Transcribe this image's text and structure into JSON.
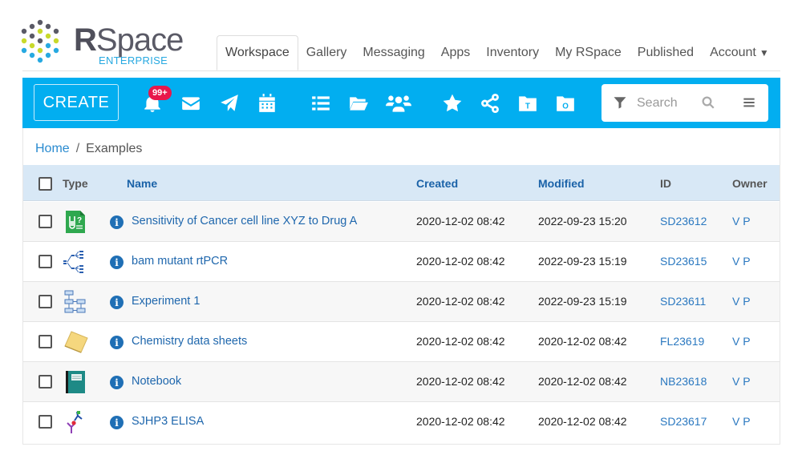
{
  "app": {
    "logo_text_bold": "R",
    "logo_text": "Space",
    "logo_subtitle": "ENTERPRISE"
  },
  "nav": {
    "tabs": [
      {
        "label": "Workspace",
        "active": true
      },
      {
        "label": "Gallery"
      },
      {
        "label": "Messaging"
      },
      {
        "label": "Apps"
      },
      {
        "label": "Inventory"
      },
      {
        "label": "My RSpace"
      },
      {
        "label": "Published"
      },
      {
        "label": "Account",
        "caret": "▼"
      }
    ]
  },
  "toolbar": {
    "create_label": "CREATE",
    "notification_badge": "99+",
    "icons": [
      "bell-icon",
      "envelope-icon",
      "paper-plane-icon",
      "calendar-icon",
      "list-icon",
      "folder-open-icon",
      "users-icon",
      "star-icon",
      "share-icon",
      "template-folder-icon",
      "other-folder-icon"
    ],
    "template_letter": "T",
    "other_letter": "O",
    "search_placeholder": "Search",
    "search_value": ""
  },
  "colors": {
    "toolbar_bg": "#02aef0",
    "badge": "#e8174b",
    "link": "#1f67ad",
    "header_bg": "#d8e8f6"
  },
  "breadcrumb": {
    "home": "Home",
    "separator": "/",
    "current": "Examples"
  },
  "table": {
    "columns": {
      "type": "Type",
      "name": "Name",
      "created": "Created",
      "modified": "Modified",
      "id": "ID",
      "owner": "Owner"
    },
    "rows": [
      {
        "type": "structured-document",
        "name": "Sensitivity of Cancer cell line XYZ to Drug A",
        "created": "2020-12-02 08:42",
        "modified": "2022-09-23 15:20",
        "id": "SD23612",
        "owner": "V P"
      },
      {
        "type": "pcr-tree",
        "name": "bam mutant rtPCR",
        "created": "2020-12-02 08:42",
        "modified": "2022-09-23 15:19",
        "id": "SD23615",
        "owner": "V P"
      },
      {
        "type": "flowchart",
        "name": "Experiment 1",
        "created": "2020-12-02 08:42",
        "modified": "2022-09-23 15:19",
        "id": "SD23611",
        "owner": "V P"
      },
      {
        "type": "folder",
        "name": "Chemistry data sheets",
        "created": "2020-12-02 08:42",
        "modified": "2020-12-02 08:42",
        "id": "FL23619",
        "owner": "V P"
      },
      {
        "type": "notebook",
        "name": "Notebook",
        "created": "2020-12-02 08:42",
        "modified": "2020-12-02 08:42",
        "id": "NB23618",
        "owner": "V P"
      },
      {
        "type": "elisa",
        "name": "SJHP3 ELISA",
        "created": "2020-12-02 08:42",
        "modified": "2020-12-02 08:42",
        "id": "SD23617",
        "owner": "V P"
      }
    ]
  }
}
